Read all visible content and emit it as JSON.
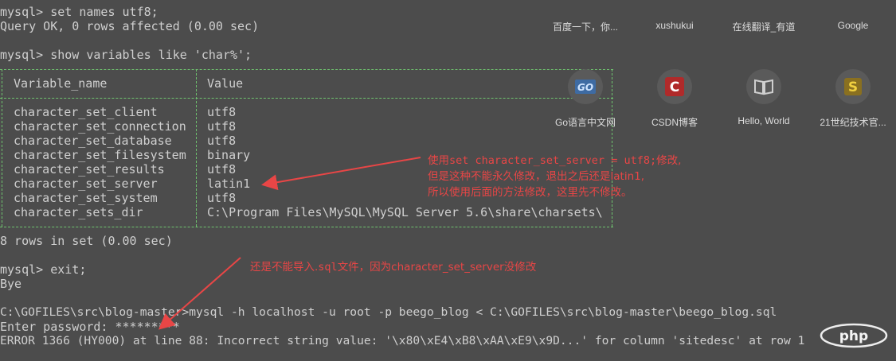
{
  "terminal": {
    "cmd1": "mysql> set names utf8;",
    "ok1": "Query OK, 0 rows affected (0.00 sec)",
    "cmd2": "mysql> show variables like 'char%';",
    "header": {
      "col1": "Variable_name",
      "col2": "Value"
    },
    "rows": [
      {
        "name": "character_set_client",
        "value": "utf8"
      },
      {
        "name": "character_set_connection",
        "value": "utf8"
      },
      {
        "name": "character_set_database",
        "value": "utf8"
      },
      {
        "name": "character_set_filesystem",
        "value": "binary"
      },
      {
        "name": "character_set_results",
        "value": "utf8"
      },
      {
        "name": "character_set_server",
        "value": "latin1"
      },
      {
        "name": "character_set_system",
        "value": "utf8"
      },
      {
        "name": "character_sets_dir",
        "value": "C:\\Program Files\\MySQL\\MySQL Server 5.6\\share\\charsets\\"
      }
    ],
    "rows_summary": "8 rows in set (0.00 sec)",
    "cmd3": "mysql> exit;",
    "bye": "Bye",
    "cmd4": "C:\\GOFILES\\src\\blog-master>mysql -h localhost -u root -p beego_blog < C:\\GOFILES\\src\\blog-master\\beego_blog.sql",
    "password": "Enter password: *********",
    "error": "ERROR 1366 (HY000) at line 88: Incorrect string value: '\\x80\\xE4\\xB8\\xAA\\xE9\\x9D...' for column 'sitedesc' at row 1"
  },
  "shortcuts": {
    "top": [
      "百度一下，你...",
      "xushukui",
      "在线翻译_有道",
      "Google"
    ],
    "tiles": [
      {
        "label": "Go语言中文网",
        "icon": "go-icon"
      },
      {
        "label": "CSDN博客",
        "icon": "csdn-icon"
      },
      {
        "label": "Hello, World",
        "icon": "book-icon"
      },
      {
        "label": "21世纪技术官...",
        "icon": "s-icon"
      }
    ]
  },
  "annotations": {
    "note1_line1_a": "使用",
    "note1_line1_code": "set character_set_server = utf8;",
    "note1_line1_b": "修改,",
    "note1_line2": "但是这种不能永久修改，退出之后还是latin1,",
    "note1_line3": "所以使用后面的方法修改，这里先不修改。",
    "note2_a": "还是不能导入.",
    "note2_code": "sql",
    "note2_b": "文件，因为character_set_server没修改"
  },
  "watermark": {
    "text": "php"
  },
  "colors": {
    "background": "#4c4c4c",
    "text": "#cfcfcf",
    "border": "#6fc46f",
    "annotation": "#e84646"
  }
}
